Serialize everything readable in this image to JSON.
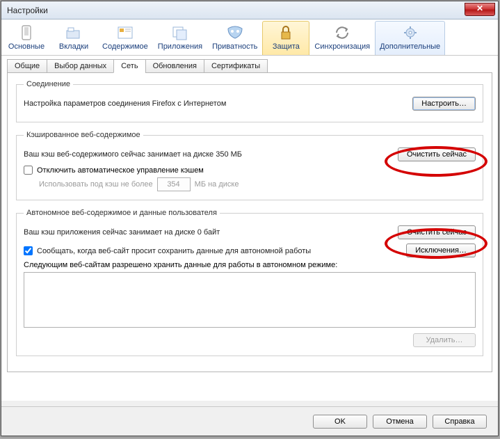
{
  "window": {
    "title": "Настройки"
  },
  "toolbar": {
    "items": [
      {
        "label": "Основные"
      },
      {
        "label": "Вкладки"
      },
      {
        "label": "Содержимое"
      },
      {
        "label": "Приложения"
      },
      {
        "label": "Приватность"
      },
      {
        "label": "Защита"
      },
      {
        "label": "Синхронизация"
      },
      {
        "label": "Дополнительные"
      }
    ]
  },
  "subtabs": {
    "items": [
      {
        "label": "Общие"
      },
      {
        "label": "Выбор данных"
      },
      {
        "label": "Сеть"
      },
      {
        "label": "Обновления"
      },
      {
        "label": "Сертификаты"
      }
    ],
    "active_index": 2
  },
  "connection": {
    "legend": "Соединение",
    "desc": "Настройка параметров соединения Firefox с Интернетом",
    "button": "Настроить…"
  },
  "cache": {
    "legend": "Кэшированное веб-содержимое",
    "status": "Ваш кэш веб-содержимого сейчас занимает на диске 350 МБ",
    "clear": "Очистить сейчас",
    "disable_label": "Отключить автоматическое управление кэшем",
    "limit_prefix": "Использовать под кэш не более",
    "limit_value": "354",
    "limit_suffix": "МБ на диске"
  },
  "offline": {
    "legend": "Автономное веб-содержимое и данные пользователя",
    "status": "Ваш кэш приложения сейчас занимает на диске 0 байт",
    "clear": "Очистить сейчас",
    "notify_label": "Сообщать, когда веб-сайт просит сохранить данные для автономной работы",
    "exceptions": "Исключения…",
    "sites_label": "Следующим веб-сайтам разрешено хранить данные для работы в автономном режиме:",
    "delete": "Удалить…"
  },
  "buttons": {
    "ok": "OK",
    "cancel": "Отмена",
    "help": "Справка"
  }
}
